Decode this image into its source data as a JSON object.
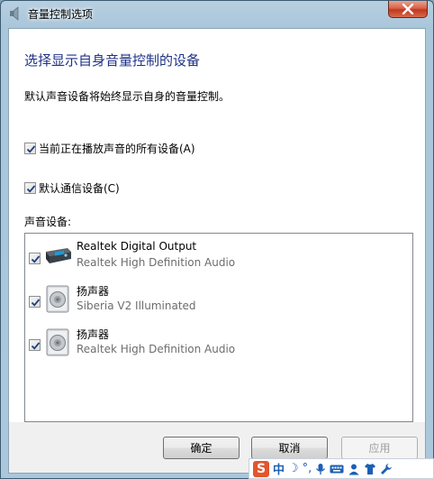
{
  "window": {
    "title": "音量控制选项"
  },
  "main": {
    "heading": "选择显示自身音量控制的设备",
    "description": "默认声音设备将始终显示自身的音量控制。"
  },
  "options": [
    {
      "label": "当前正在播放声音的所有设备(A)",
      "checked": true
    },
    {
      "label": "默认通信设备(C)",
      "checked": true
    }
  ],
  "devices_label": "声音设备:",
  "devices": [
    {
      "name": "Realtek Digital Output",
      "sub": "Realtek High Definition Audio",
      "checked": true,
      "icon": "digital-output-icon"
    },
    {
      "name": "扬声器",
      "sub": "Siberia V2 Illuminated",
      "checked": true,
      "icon": "speaker-icon"
    },
    {
      "name": "扬声器",
      "sub": "Realtek High Definition Audio",
      "checked": true,
      "icon": "speaker-icon"
    }
  ],
  "buttons": {
    "ok": "确定",
    "cancel": "取消",
    "apply": "应用"
  },
  "ime": {
    "logo": "S",
    "mode": "中",
    "moon": "☽",
    "punct": "°,"
  }
}
